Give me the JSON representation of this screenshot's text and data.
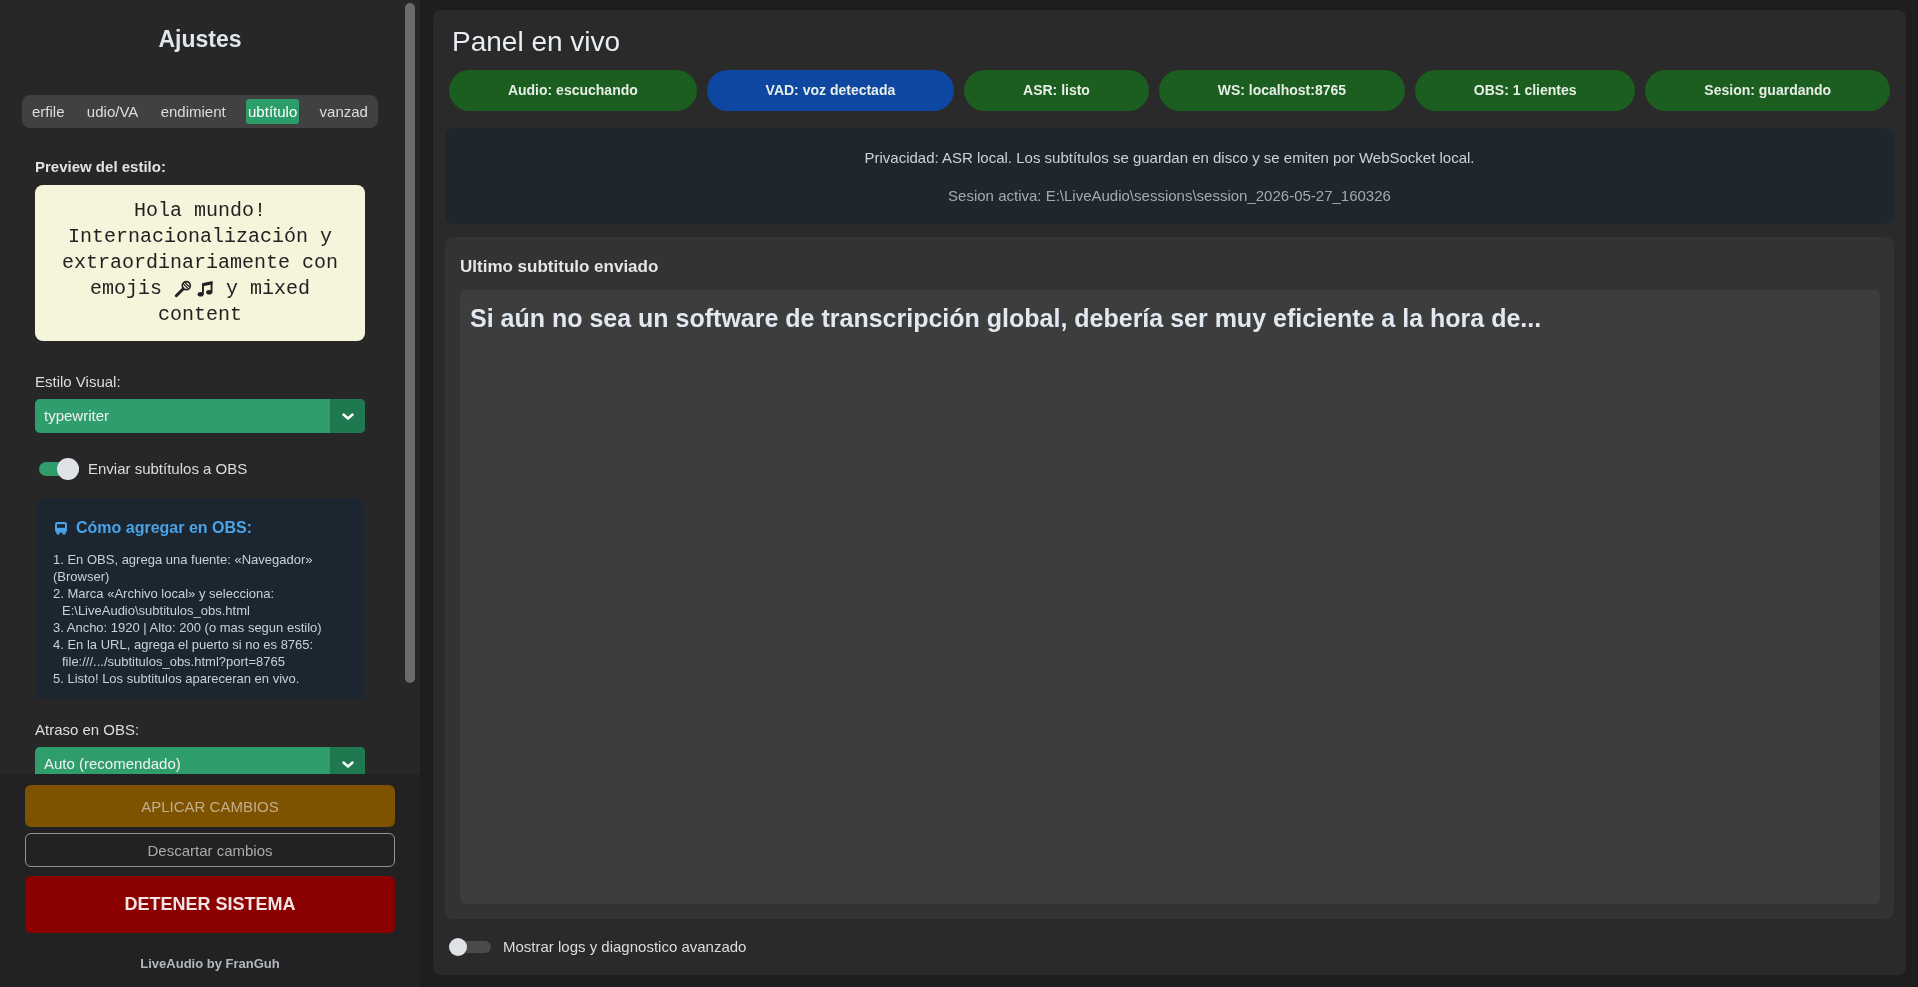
{
  "sidebar": {
    "title": "Ajustes",
    "tabs": [
      {
        "label": "erfile",
        "selected": false
      },
      {
        "label": "udio/VA",
        "selected": false
      },
      {
        "label": "endimient",
        "selected": false
      },
      {
        "label": "ubtítulo",
        "selected": true
      },
      {
        "label": "vanzad",
        "selected": false
      }
    ],
    "preview": {
      "label": "Preview del estilo:",
      "text": "Hola mundo! Internacionalización y extraordinariamente con",
      "before_icons": "emojis",
      "after_icons": "y mixed",
      "last_line": "content"
    },
    "style_select": {
      "label": "Estilo Visual:",
      "value": "typewriter"
    },
    "obs_toggle": {
      "label": "Enviar subtítulos a OBS",
      "on": true
    },
    "obs_help": {
      "title": "Cómo agregar en OBS:",
      "steps": [
        {
          "text": "1. En OBS, agrega una fuente: «Navegador» (Browser)"
        },
        {
          "text": "2. Marca «Archivo local» y selecciona:",
          "detail": "E:\\LiveAudio\\subtitulos_obs.html"
        },
        {
          "text": "3. Ancho: 1920 | Alto: 200 (o mas segun estilo)"
        },
        {
          "text": "4. En la URL, agrega el puerto si no es 8765:",
          "detail": "file:///.../subtitulos_obs.html?port=8765"
        },
        {
          "text": "5. Listo! Los subtitulos apareceran en vivo."
        }
      ]
    },
    "delay_select": {
      "label": "Atraso en OBS:",
      "value": "Auto (recomendado)"
    },
    "buttons": [
      {
        "kind": "apply",
        "label": "APLICAR CAMBIOS",
        "disabled": true
      },
      {
        "kind": "discard",
        "label": "Descartar cambios",
        "disabled": true
      },
      {
        "kind": "stop",
        "label": "DETENER SISTEMA",
        "disabled": false
      }
    ],
    "footer": "LiveAudio by FranGuh"
  },
  "panel": {
    "title": "Panel en vivo",
    "status_badges": [
      {
        "label": "Audio: escuchando",
        "color": "#1b5e20"
      },
      {
        "label": "VAD: voz detectada",
        "color": "#0d47a1"
      },
      {
        "label": "ASR: listo",
        "color": "#1b5e20"
      },
      {
        "label": "WS: localhost:8765",
        "color": "#1b5e20"
      },
      {
        "label": "OBS: 1 clientes",
        "color": "#1b5e20"
      },
      {
        "label": "Sesion: guardando",
        "color": "#1b5e20"
      }
    ],
    "info": {
      "privacy": "Privacidad: ASR local. Los subtítulos se guardan en disco y se emiten por WebSocket local.",
      "session": "Sesion activa: E:\\LiveAudio\\sessions\\session_2026-05-27_160326"
    },
    "last_subtitle": {
      "heading": "Ultimo subtitulo enviado",
      "text": "Si aún no sea un software de transcripción global, debería ser muy eficiente a la hora de..."
    },
    "logs_toggle": {
      "label": "Mostrar logs y diagnostico avanzado",
      "on": false
    }
  }
}
